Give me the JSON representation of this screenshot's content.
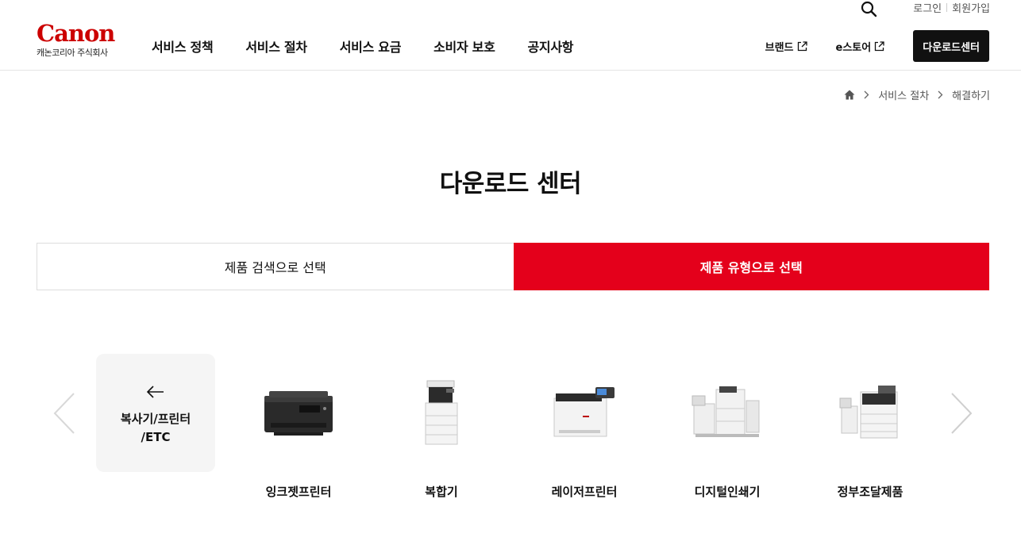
{
  "header": {
    "util": {
      "login": "로그인",
      "signup": "회원가입"
    },
    "logo": {
      "wordmark": "Canon",
      "subtitle": "캐논코리아 주식회사"
    },
    "gnb": [
      {
        "label": "서비스 정책"
      },
      {
        "label": "서비스 절차"
      },
      {
        "label": "서비스 요금"
      },
      {
        "label": "소비자 보호"
      },
      {
        "label": "공지사항"
      }
    ],
    "brand_link": "브랜드",
    "estore_link": "e스토어",
    "download_button": "다운로드센터"
  },
  "breadcrumb": {
    "home_icon": "home-icon",
    "items": [
      "서비스 절차",
      "해결하기"
    ]
  },
  "page": {
    "title": "다운로드 센터"
  },
  "tabs": [
    {
      "label": "제품 검색으로 선택",
      "active": false
    },
    {
      "label": "제품 유형으로 선택",
      "active": true
    }
  ],
  "category": {
    "back_label_line1": "복사기/프린터",
    "back_label_line2": "/ETC",
    "products": [
      {
        "label": "잉크젯프린터",
        "icon": "inkjet-printer-icon"
      },
      {
        "label": "복합기",
        "icon": "multifunction-printer-icon"
      },
      {
        "label": "레이저프린터",
        "icon": "laser-printer-icon"
      },
      {
        "label": "디지털인쇄기",
        "icon": "digital-press-icon"
      },
      {
        "label": "정부조달제품",
        "icon": "government-procurement-icon"
      }
    ]
  },
  "colors": {
    "brand_red": "#cc0000",
    "active_tab": "#e4001b",
    "dark_button": "#111111"
  }
}
